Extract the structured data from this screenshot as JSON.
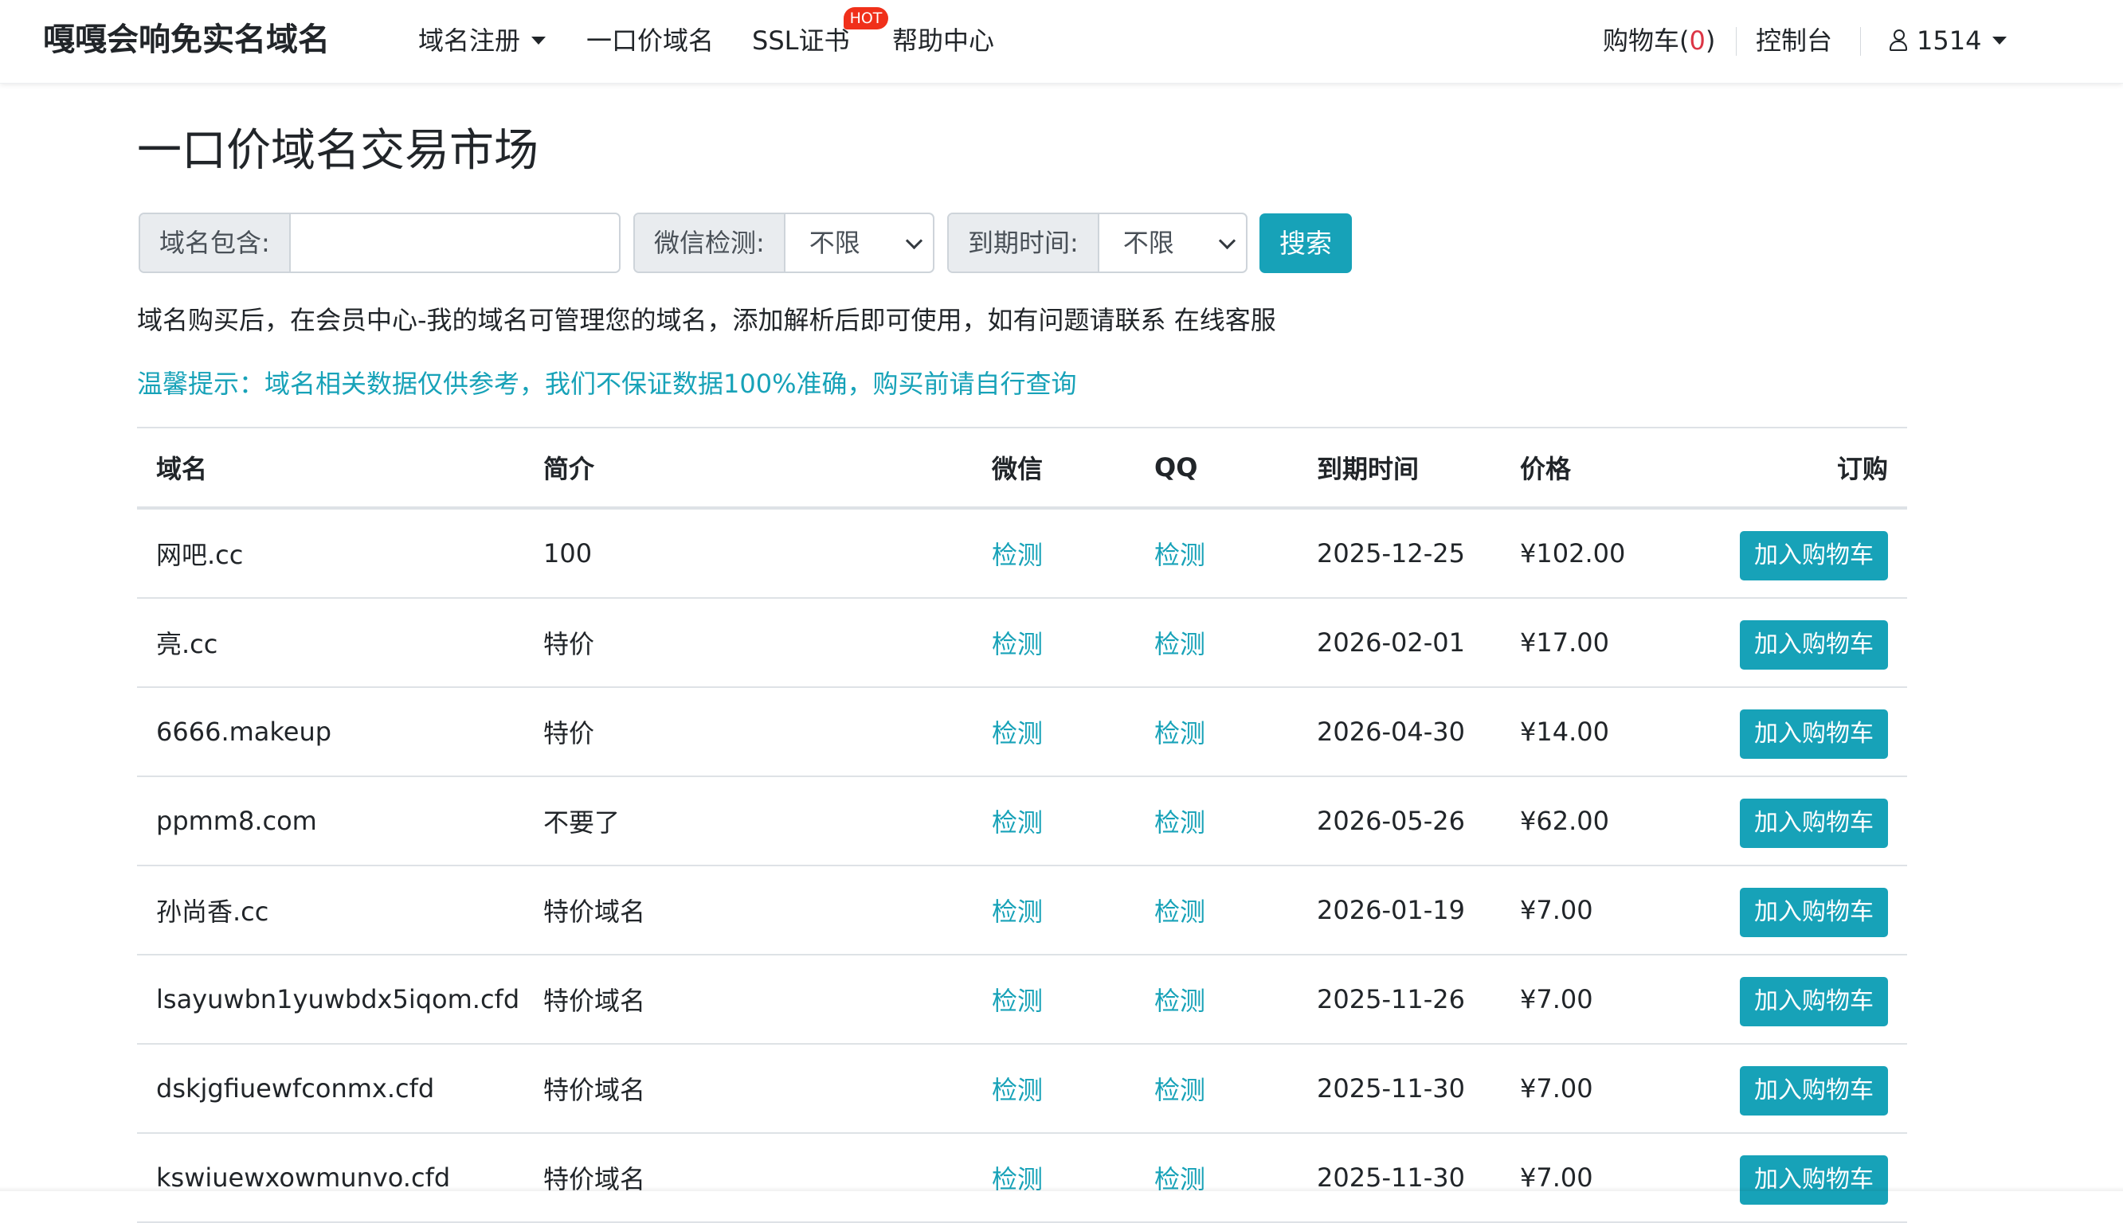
{
  "nav": {
    "brand": "嘎嘎会响免实名域名",
    "items": {
      "register": "域名注册",
      "fixed_price": "一口价域名",
      "ssl": "SSL证书",
      "ssl_badge": "HOT",
      "help": "帮助中心"
    },
    "cart_label": "购物车(",
    "cart_count": "0",
    "cart_close": ")",
    "console": "控制台",
    "user": "1514"
  },
  "page": {
    "title": "一口价域名交易市场"
  },
  "search": {
    "domain_label": "域名包含:",
    "domain_value": "",
    "wechat_label": "微信检测:",
    "wechat_value": "不限",
    "expire_label": "到期时间:",
    "expire_value": "不限",
    "button": "搜索"
  },
  "info": "域名购买后，在会员中心-我的域名可管理您的域名，添加解析后即可使用，如有问题请联系 在线客服",
  "tip": "温馨提示：域名相关数据仅供参考，我们不保证数据100%准确，购买前请自行查询",
  "table": {
    "headers": {
      "domain": "域名",
      "intro": "简介",
      "wechat": "微信",
      "qq": "QQ",
      "expire": "到期时间",
      "price": "价格",
      "order": "订购"
    },
    "check_label": "检测",
    "add_label": "加入购物车",
    "rows": [
      {
        "domain": "网吧.cc",
        "intro": "100",
        "expire": "2025-12-25",
        "price": "¥102.00"
      },
      {
        "domain": "亮.cc",
        "intro": "特价",
        "expire": "2026-02-01",
        "price": "¥17.00"
      },
      {
        "domain": "6666.makeup",
        "intro": "特价",
        "expire": "2026-04-30",
        "price": "¥14.00"
      },
      {
        "domain": "ppmm8.com",
        "intro": "不要了",
        "expire": "2026-05-26",
        "price": "¥62.00"
      },
      {
        "domain": "孙尚香.cc",
        "intro": "特价域名",
        "expire": "2026-01-19",
        "price": "¥7.00"
      },
      {
        "domain": "lsayuwbn1yuwbdx5iqom.cfd",
        "intro": "特价域名",
        "expire": "2025-11-26",
        "price": "¥7.00"
      },
      {
        "domain": "dskjgfiuewfconmx.cfd",
        "intro": "特价域名",
        "expire": "2025-11-30",
        "price": "¥7.00"
      },
      {
        "domain": "kswiuewxowmunvo.cfd",
        "intro": "特价域名",
        "expire": "2025-11-30",
        "price": "¥7.00"
      }
    ]
  },
  "colors": {
    "accent": "#17a2b8",
    "price": "#dc3545",
    "badge": "#f0301a"
  }
}
